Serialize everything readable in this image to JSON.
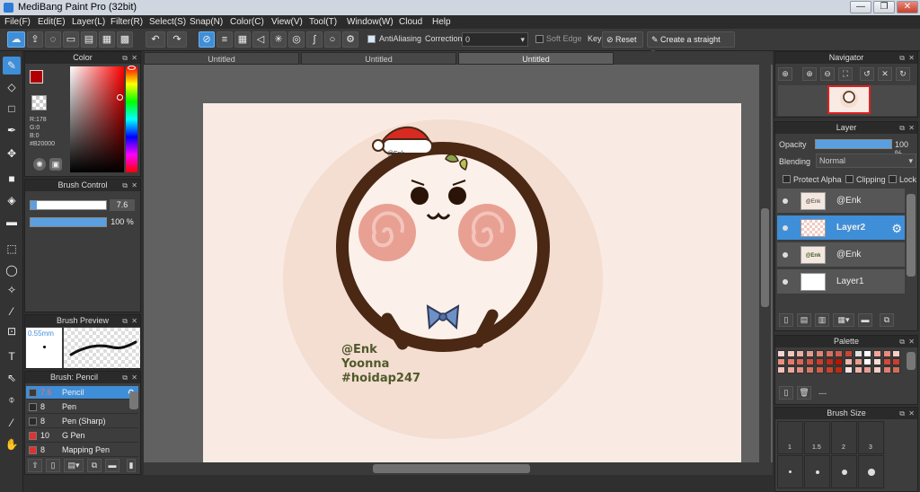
{
  "window": {
    "title": "MediBang Paint Pro (32bit)",
    "minimize": "—",
    "maximize": "❐",
    "close": "✕"
  },
  "menu": [
    "File(F)",
    "Edit(E)",
    "Layer(L)",
    "Filter(R)",
    "Select(S)",
    "Snap(N)",
    "Color(C)",
    "View(V)",
    "Tool(T)",
    "Window(W)",
    "Cloud",
    "Help"
  ],
  "toolbar": {
    "antialiasing_label": "AntiAliasing",
    "correction_label": "Correction",
    "correction_value": "0",
    "soft_edge_label": "Soft Edge",
    "key_label": "Key",
    "reset_label": "Reset",
    "straight_line_label": "Create a straight line"
  },
  "color_panel": {
    "title": "Color",
    "r": "R:178",
    "g": "G:0",
    "b": "B:0",
    "hex": "#B20000",
    "main_color": "#b20000"
  },
  "brush_control": {
    "title": "Brush Control",
    "size": "7.6",
    "opacity": "100 %",
    "size_fraction": 0.08,
    "opacity_fraction": 1.0
  },
  "brush_preview": {
    "title": "Brush Preview",
    "size": "0.55mm"
  },
  "brush_list": {
    "title": "Brush: Pencil",
    "items": [
      {
        "size": "7.6",
        "name": "Pencil",
        "color": "#3a3a3a",
        "selected": true
      },
      {
        "size": "8",
        "name": "Pen",
        "color": "#2a2a2a",
        "selected": false
      },
      {
        "size": "8",
        "name": "Pen (Sharp)",
        "color": "#2a2a2a",
        "selected": false
      },
      {
        "size": "10",
        "name": "G Pen",
        "color": "#e03030",
        "selected": false
      },
      {
        "size": "8",
        "name": "Mapping Pen",
        "color": "#e03030",
        "selected": false
      }
    ]
  },
  "tabs": [
    "Untitled",
    "Untitled",
    "Untitled"
  ],
  "artwork": {
    "watermark_line1": "@Enk",
    "watermark_line2": "Yoonna",
    "watermark_line3": "#hoidap247",
    "hat_label": "@Enk"
  },
  "navigator": {
    "title": "Navigator"
  },
  "layer_panel": {
    "title": "Layer",
    "opacity_label": "Opacity",
    "opacity_value": "100 %",
    "opacity_fraction": 1.0,
    "blending_label": "Blending",
    "blending_value": "Normal",
    "protect_alpha": "Protect Alpha",
    "clipping": "Clipping",
    "lock": "Lock",
    "layers": [
      {
        "name": "@Enk",
        "thumb": "@Enk",
        "selected": false
      },
      {
        "name": "Layer2",
        "thumb": "",
        "selected": true
      },
      {
        "name": "@Enk",
        "thumb": "@Enk",
        "selected": false
      },
      {
        "name": "Layer1",
        "thumb": "",
        "selected": false
      }
    ]
  },
  "palette": {
    "title": "Palette",
    "value": "---"
  },
  "brush_size": {
    "title": "Brush Size",
    "labels": [
      "1",
      "1.5",
      "2",
      "3"
    ]
  }
}
